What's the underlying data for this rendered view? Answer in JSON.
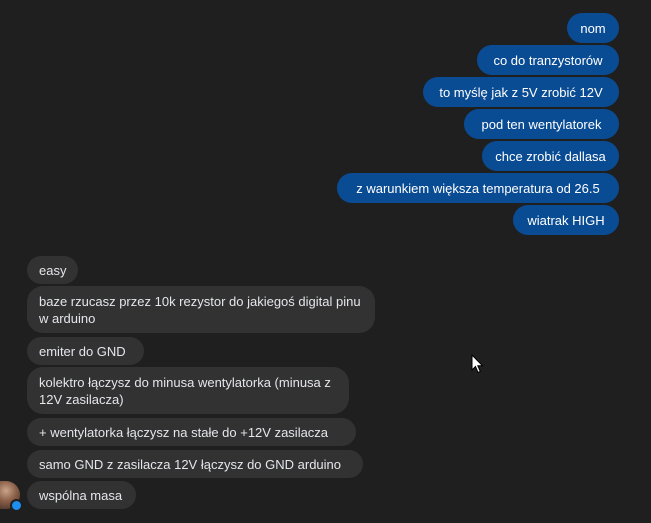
{
  "outgoing": [
    "nom",
    "co do tranzystorów",
    "to myślę jak z 5V zrobić 12V",
    "pod ten wentylatorek",
    "chce zrobić dallasa",
    "z warunkiem większa temperatura od 26.5",
    "wiatrak HIGH"
  ],
  "incoming": [
    "easy",
    "baze rzucasz przez 10k rezystor do jakiegoś digital pinu w arduino",
    "emiter do GND",
    "kolektro łączysz do minusa wentylatorka (minusa z 12V zasilacza)",
    "+ wentylatorka łączysz na stałe do +12V zasilacza",
    "samo GND z zasilacza 12V łączysz do GND arduino",
    "wspólna masa"
  ],
  "colors": {
    "background": "#1f1f1f",
    "outgoing_bubble": "#0a4c93",
    "incoming_bubble": "#323232",
    "incoming_text": "#e4e6eb",
    "online_badge": "#1f8ef1"
  },
  "icons": {
    "cursor": "arrow-cursor-icon",
    "avatar": "contact-avatar"
  }
}
